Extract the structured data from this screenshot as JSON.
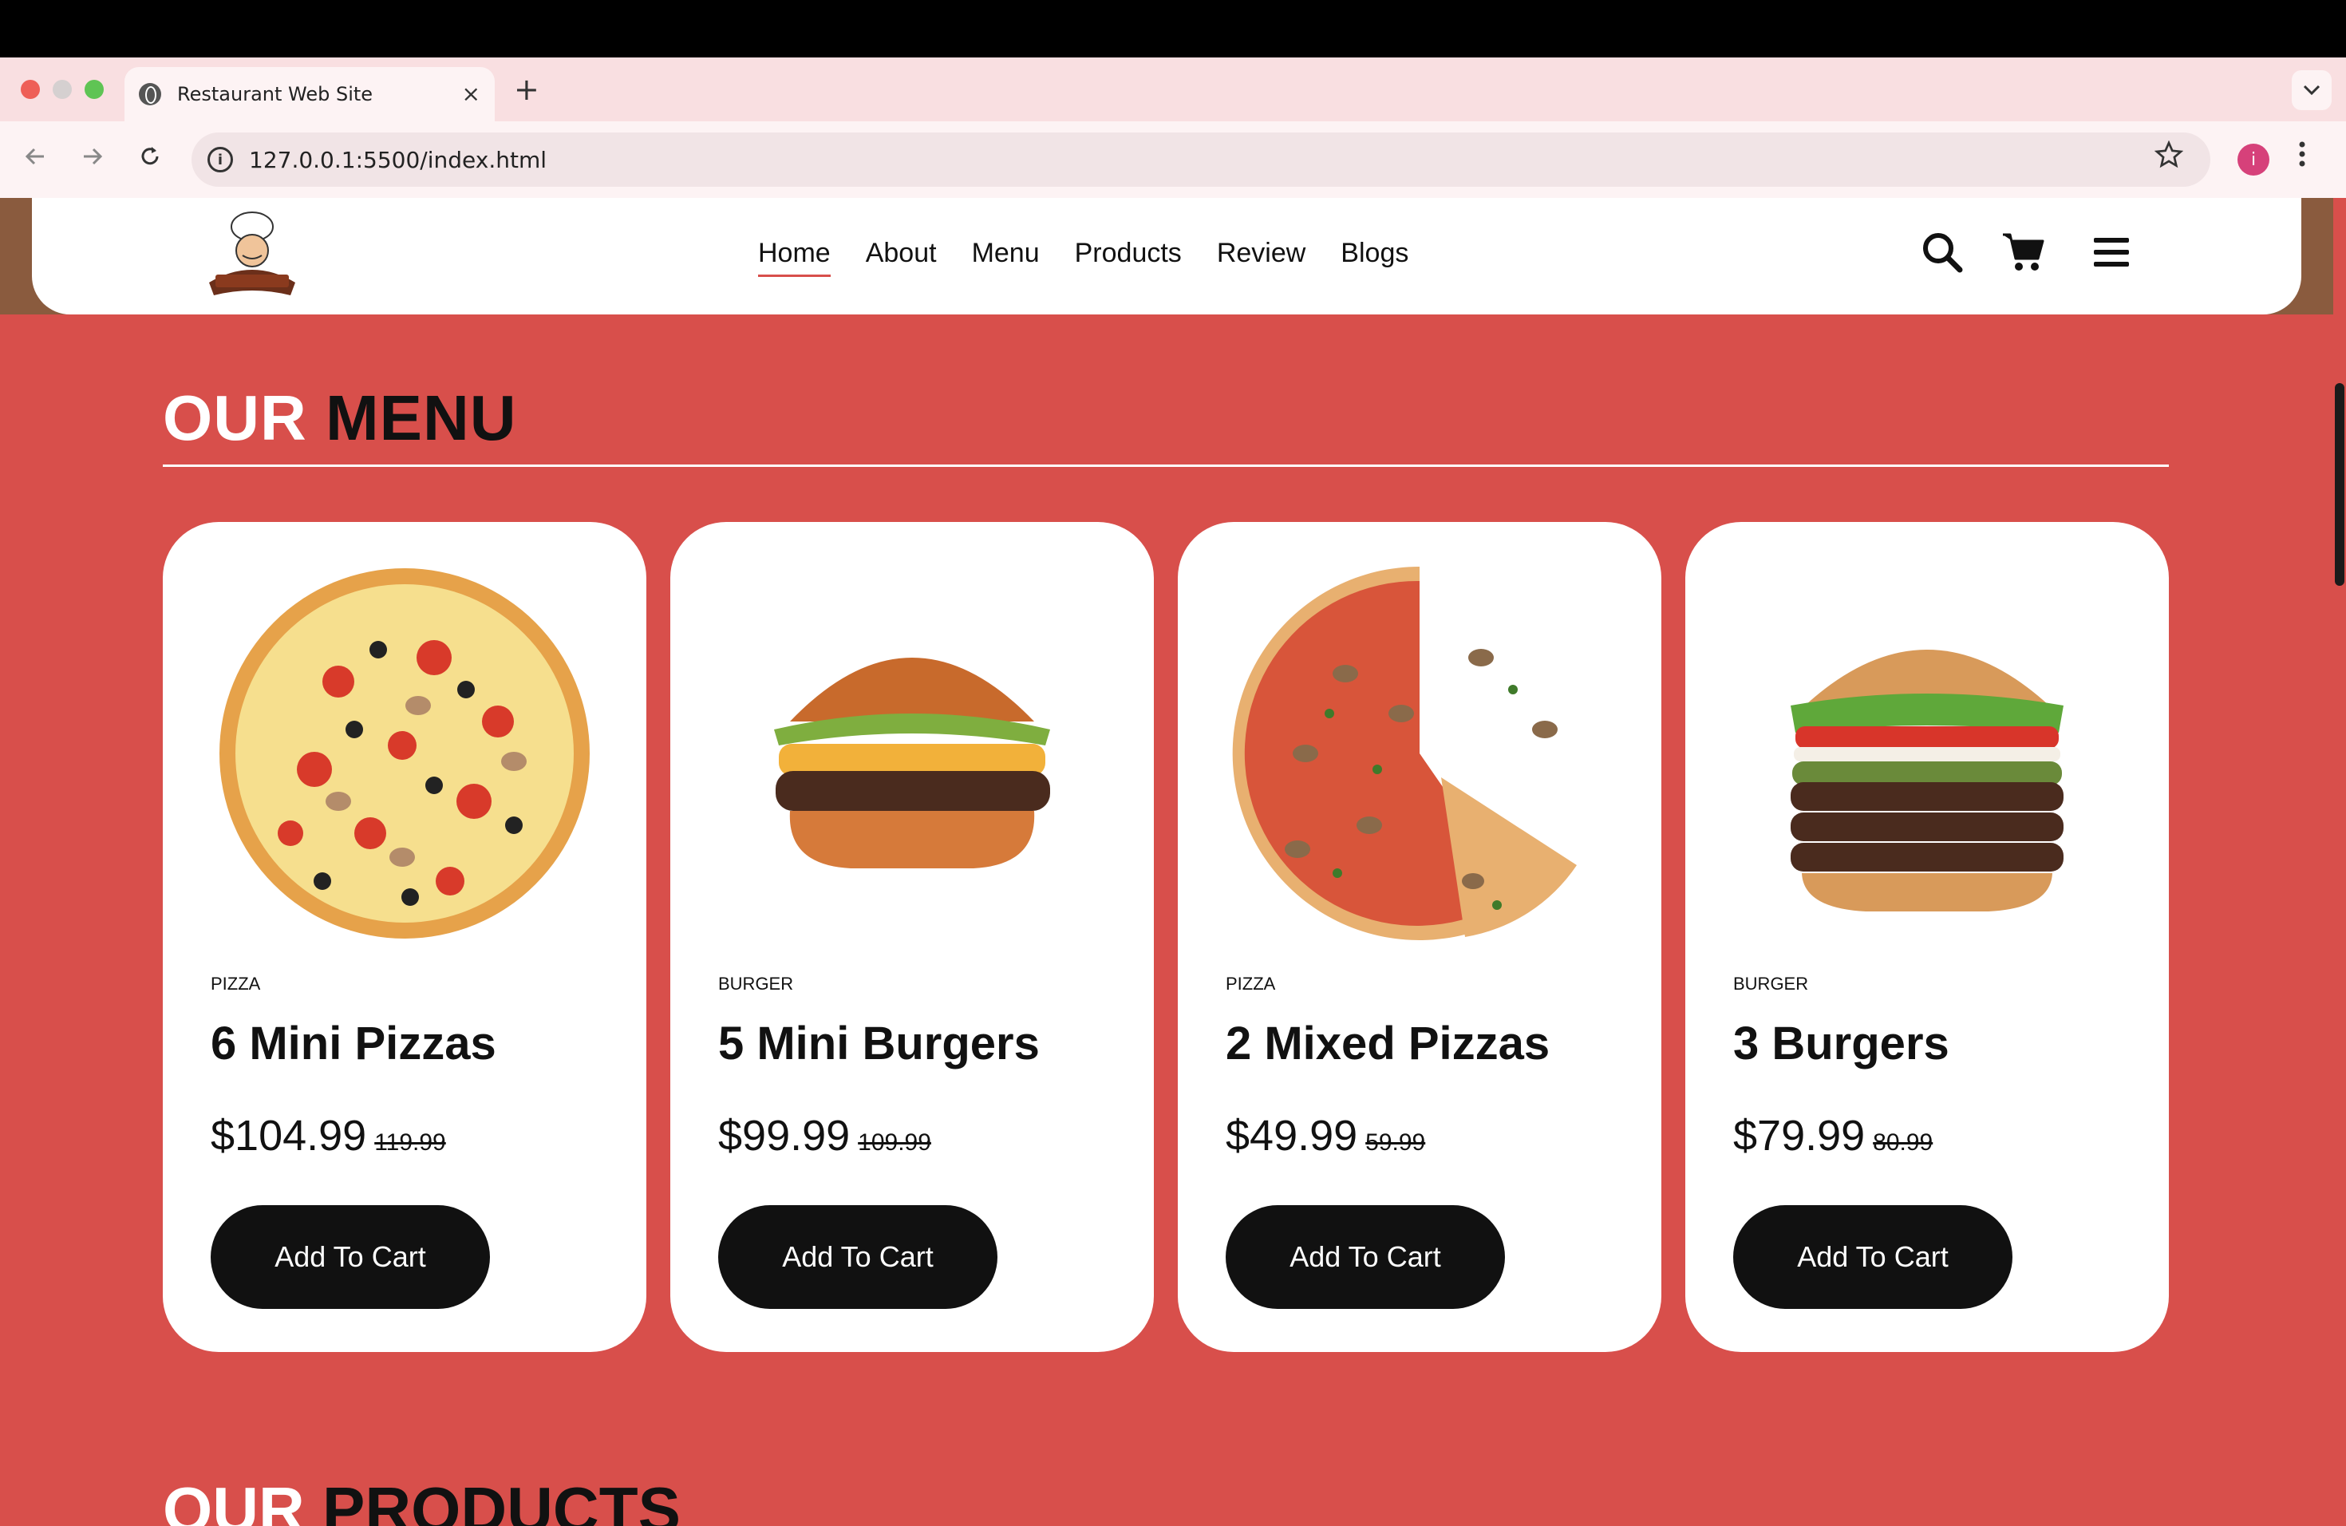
{
  "browser": {
    "tab_title": "Restaurant Web Site",
    "tab_close": "×",
    "new_tab": "+",
    "url": "127.0.0.1:5500/index.html",
    "avatar_letter": "i"
  },
  "header": {
    "nav": [
      "Home",
      "About",
      "Menu",
      "Products",
      "Review",
      "Blogs"
    ],
    "active": "Home"
  },
  "menu_section": {
    "title_part1": "OUR",
    "title_part2": "MENU",
    "add_to_cart_label": "Add To Cart",
    "items": [
      {
        "category": "PIZZA",
        "name": "6 Mini Pizzas",
        "price": "$104.99",
        "old_price": "119.99",
        "image": "pizza-image"
      },
      {
        "category": "BURGER",
        "name": "5 Mini Burgers",
        "price": "$99.99",
        "old_price": "109.99",
        "image": "burger-image"
      },
      {
        "category": "PIZZA",
        "name": "2 Mixed Pizzas",
        "price": "$49.99",
        "old_price": "59.99",
        "image": "pizza-sliced-image"
      },
      {
        "category": "BURGER",
        "name": "3 Burgers",
        "price": "$79.99",
        "old_price": "80.99",
        "image": "triple-burger-image"
      }
    ]
  },
  "products_section": {
    "title_part1": "OUR",
    "title_part2": "PRODUCTS"
  },
  "colors": {
    "accent": "#d84f4b",
    "dark": "#111111",
    "card": "#ffffff"
  }
}
